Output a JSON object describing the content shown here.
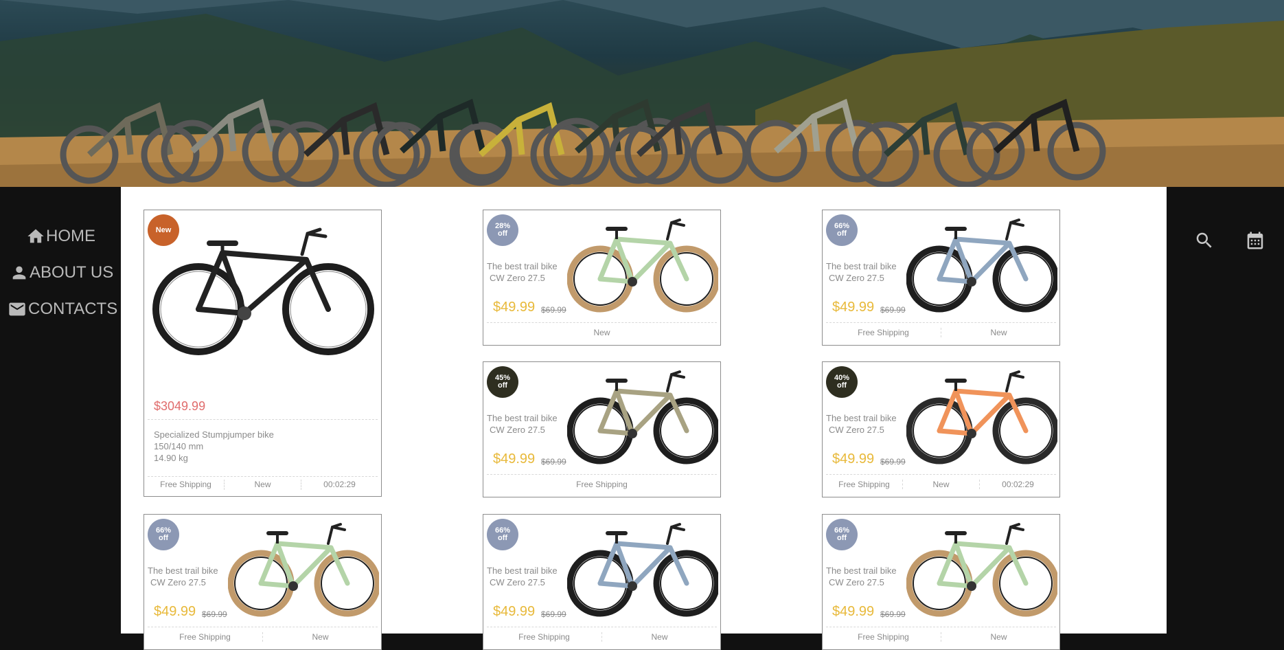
{
  "nav": {
    "home": "HOME",
    "about": "ABOUT US",
    "contacts": "CONTACTS"
  },
  "featured": {
    "badge": "New",
    "badge_color": "#c8622a",
    "price": "$3049.99",
    "specs": [
      "Specialized Stumpjumper bike",
      "150/140 mm",
      "14.90 kg"
    ],
    "footer": [
      "Free Shipping",
      "New",
      "00:02:29"
    ]
  },
  "products": [
    {
      "badge": [
        "28%",
        "off"
      ],
      "badge_color": "#8c98b4",
      "title": [
        "The best trail bike",
        "CW Zero 27.5"
      ],
      "price": "$49.99",
      "old_price": "$69.99",
      "footer": [
        "New"
      ],
      "frame": "#b4d4a8",
      "tire": "#c19a6b"
    },
    {
      "badge": [
        "66%",
        "off"
      ],
      "badge_color": "#8c98b4",
      "title": [
        "The best trail bike",
        "CW Zero 27.5"
      ],
      "price": "$49.99",
      "old_price": "$69.99",
      "footer": [
        "Free Shipping",
        "New"
      ],
      "frame": "#8fa6bf",
      "tire": "#1e1e1e"
    },
    {
      "badge": [
        "45%",
        "off"
      ],
      "badge_color": "#2e2e20",
      "title": [
        "The best trail bike",
        "CW Zero 27.5"
      ],
      "price": "$49.99",
      "old_price": "$69.99",
      "footer": [
        "Free Shipping"
      ],
      "frame": "#a8a282",
      "tire": "#1e1e1e"
    },
    {
      "badge": [
        "40%",
        "off"
      ],
      "badge_color": "#2e2e20",
      "title": [
        "The best trail bike",
        "CW Zero 27.5"
      ],
      "price": "$49.99",
      "old_price": "$69.99",
      "footer": [
        "Free Shipping",
        "New",
        "00:02:29"
      ],
      "frame": "#f0935a",
      "tire": "#2a2a2a"
    },
    {
      "badge": [
        "66%",
        "off"
      ],
      "badge_color": "#8c98b4",
      "title": [
        "The best trail bike",
        "CW Zero 27.5"
      ],
      "price": "$49.99",
      "old_price": "$69.99",
      "footer": [
        "Free Shipping",
        "New"
      ],
      "frame": "#b4d4a8",
      "tire": "#c19a6b"
    },
    {
      "badge": [
        "66%",
        "off"
      ],
      "badge_color": "#8c98b4",
      "title": [
        "The best trail bike",
        "CW Zero 27.5"
      ],
      "price": "$49.99",
      "old_price": "$69.99",
      "footer": [
        "Free Shipping",
        "New"
      ],
      "frame": "#8fa6bf",
      "tire": "#1e1e1e"
    },
    {
      "badge": [
        "66%",
        "off"
      ],
      "badge_color": "#8c98b4",
      "title": [
        "The best trail bike",
        "CW Zero 27.5"
      ],
      "price": "$49.99",
      "old_price": "$69.99",
      "footer": [
        "Free Shipping",
        "New"
      ],
      "frame": "#b4d4a8",
      "tire": "#c19a6b"
    }
  ],
  "icons": {
    "home": "home-icon",
    "about": "person-icon",
    "contacts": "mail-icon",
    "search": "search-icon",
    "calendar": "calendar-icon"
  }
}
